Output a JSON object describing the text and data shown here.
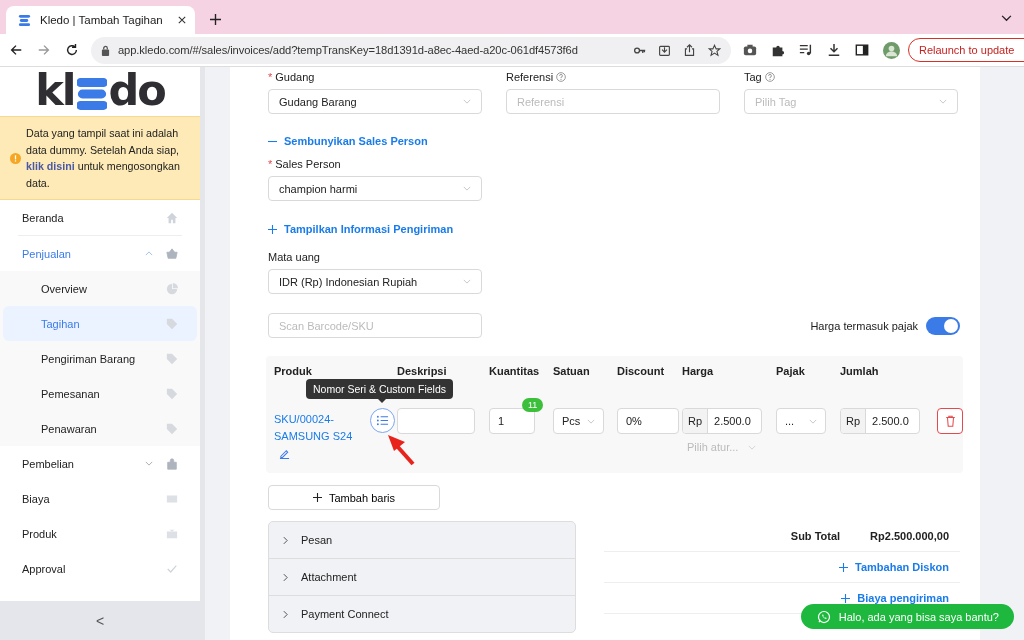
{
  "browser": {
    "tab_title": "Kledo | Tambah Tagihan",
    "url": "app.kledo.com/#/sales/invoices/add?tempTransKey=18d1391d-a8ec-4aed-a20c-061df4573f6d",
    "relaunch": "Relaunch to update"
  },
  "sidebar": {
    "logo": {
      "lead": "kl",
      "tail": "do"
    },
    "notice": {
      "before": "Data yang tampil saat ini adalah data dummy. Setelah Anda siap, ",
      "link": "klik disini",
      "after": " untuk mengosongkan data."
    },
    "items": [
      {
        "label": "Beranda",
        "selected": false
      },
      {
        "label": "Penjualan",
        "selected": true,
        "expanded": true,
        "children": [
          {
            "label": "Overview",
            "selected": false
          },
          {
            "label": "Tagihan",
            "selected": true
          },
          {
            "label": "Pengiriman Barang",
            "selected": false
          },
          {
            "label": "Pemesanan",
            "selected": false
          },
          {
            "label": "Penawaran",
            "selected": false
          }
        ]
      },
      {
        "label": "Pembelian",
        "selected": false,
        "expanded": false
      },
      {
        "label": "Biaya",
        "selected": false
      },
      {
        "label": "Produk",
        "selected": false
      },
      {
        "label": "Approval",
        "selected": false
      }
    ],
    "collapse": "<"
  },
  "form": {
    "gudang": {
      "label": "Gudang",
      "required_mark": "*",
      "value": "Gudang Barang"
    },
    "referensi": {
      "label": "Referensi",
      "placeholder": "Referensi"
    },
    "tag": {
      "label": "Tag",
      "placeholder": "Pilih Tag"
    },
    "sales_toggle": {
      "label": "Sembunyikan Sales Person",
      "expanded": true
    },
    "sales_person": {
      "label": "Sales Person",
      "required_mark": "*",
      "value": "champion harmi"
    },
    "shipping_toggle": {
      "label": "Tampilkan Informasi Pengiriman",
      "expanded": false
    },
    "currency": {
      "label": "Mata uang",
      "value": "IDR (Rp) Indonesian Rupiah"
    },
    "scan": {
      "placeholder": "Scan Barcode/SKU"
    },
    "tax_inclusive": {
      "label": "Harga termasuk pajak",
      "on": true
    }
  },
  "table": {
    "columns": [
      "Produk",
      "Deskripsi",
      "Kuantitas",
      "Satuan",
      "Discount",
      "Harga",
      "Pajak",
      "Jumlah"
    ],
    "rows": [
      {
        "product": "SKU/00024-SAMSUNG S24",
        "quantity": "1",
        "stock": "11",
        "unit": "Pcs",
        "discount": "0%",
        "price_prefix": "Rp",
        "price": "2.500.0",
        "tax": "...",
        "tax_rule": "Pilih atur...",
        "amount_prefix": "Rp",
        "amount": "2.500.0"
      }
    ],
    "tooltip": "Nomor Seri & Custom Fields"
  },
  "add_row": "Tambah baris",
  "panels": [
    {
      "label": "Pesan",
      "expanded": false
    },
    {
      "label": "Attachment",
      "expanded": false
    },
    {
      "label": "Payment Connect",
      "expanded": false
    }
  ],
  "totals": {
    "subtotal_label": "Sub Total",
    "subtotal": "Rp2.500.000,00",
    "links": [
      "Tambahan Diskon",
      "Biaya pengiriman"
    ]
  },
  "chat": "Halo, ada yang bisa saya bantu?"
}
